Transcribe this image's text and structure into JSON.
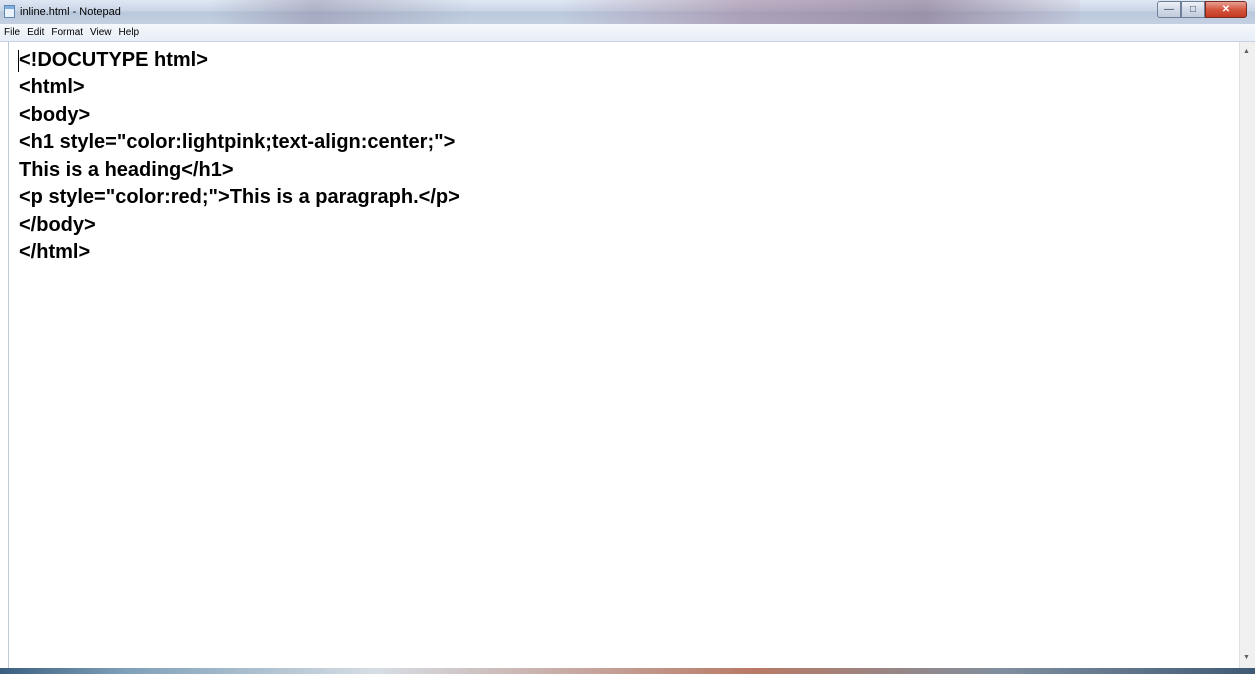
{
  "window": {
    "title": "inline.html - Notepad",
    "minimize_glyph": "—",
    "maximize_glyph": "□",
    "close_glyph": "✕"
  },
  "menu": [
    "File",
    "Edit",
    "Format",
    "View",
    "Help"
  ],
  "editor": {
    "lines": [
      "<!DOCUTYPE html>",
      "<html>",
      "<body>",
      "<h1 style=\"color:lightpink;text-align:center;\">",
      "This is a heading</h1>",
      "<p style=\"color:red;\">This is a paragraph.</p>",
      "</body>",
      "</html>"
    ]
  },
  "scrollbar": {
    "up_arrow": "▲",
    "down_arrow": "▼"
  },
  "colors": {
    "accent": "#c23a22",
    "titlebar": "#c9d5e6"
  }
}
